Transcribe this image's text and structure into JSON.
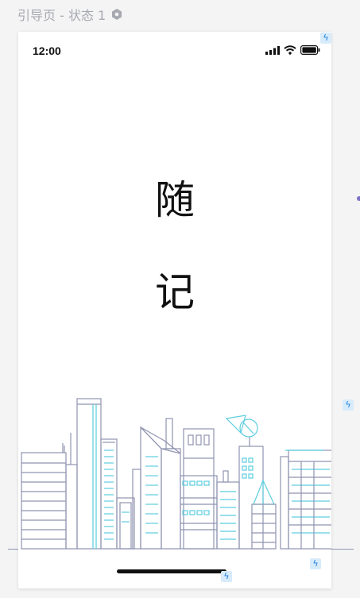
{
  "page": {
    "label": "引导页 - 状态 1",
    "label_icon": "hexagon-gear-icon"
  },
  "status_bar": {
    "time": "12:00",
    "icons": [
      "signal-icon",
      "wifi-icon",
      "battery-icon"
    ]
  },
  "main": {
    "title_chars": [
      "随",
      "记"
    ]
  },
  "illustration": {
    "name": "city-skyline-illustration",
    "stroke_color": "#8f94b0",
    "accent_color": "#5ccde0"
  },
  "badges": {
    "icon": "lightning-icon",
    "glyph": "ϟ",
    "color": "#1f7de0"
  }
}
